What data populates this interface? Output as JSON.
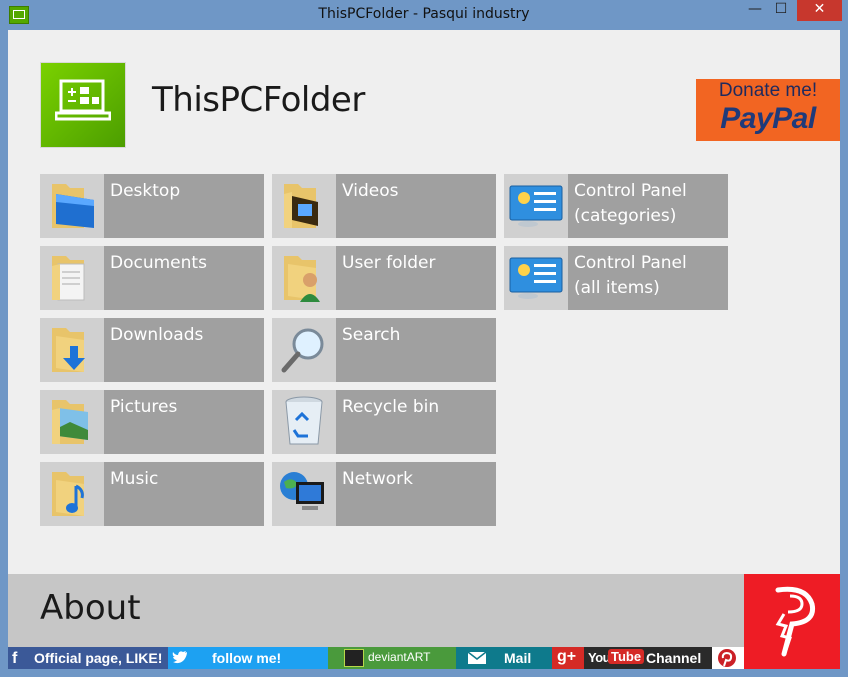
{
  "window": {
    "title": "ThisPCFolder - Pasqui industry",
    "minimize_glyph": "—",
    "maximize_glyph": "☐",
    "close_glyph": "✕"
  },
  "header": {
    "app_name": "ThisPCFolder",
    "donate_line1": "Donate me!",
    "donate_line2": "PayPal"
  },
  "tiles": [
    {
      "label": "Desktop",
      "icon": "desktop-folder-icon"
    },
    {
      "label": "Documents",
      "icon": "documents-folder-icon"
    },
    {
      "label": "Downloads",
      "icon": "downloads-folder-icon"
    },
    {
      "label": "Pictures",
      "icon": "pictures-folder-icon"
    },
    {
      "label": "Music",
      "icon": "music-folder-icon"
    },
    {
      "label": "Videos",
      "icon": "videos-folder-icon"
    },
    {
      "label": "User folder",
      "icon": "user-folder-icon"
    },
    {
      "label": "Search",
      "icon": "search-icon"
    },
    {
      "label": "Recycle bin",
      "icon": "recycle-bin-icon"
    },
    {
      "label": "Network",
      "icon": "network-icon"
    },
    {
      "label": "Control Panel\n(categories)",
      "icon": "control-panel-icon"
    },
    {
      "label": "Control Panel\n(all items)",
      "icon": "control-panel-icon"
    }
  ],
  "footer": {
    "about_label": "About",
    "facebook_label": "Official page, LIKE!",
    "twitter_label": "follow me!",
    "deviantart_label": "deviantART",
    "mail_label": "Mail",
    "youtube_you": "You",
    "youtube_tube": "Tube",
    "channel_label": "Channel",
    "gplus_label": "g+"
  },
  "colors": {
    "tile_bg": "#a0a0a0",
    "tile_icon_bg": "#d0d0d0",
    "paypal_orange": "#f26522",
    "facebook": "#3b5998",
    "twitter": "#1da1f2",
    "deviantart": "#4a9a3c",
    "mail": "#0e7a8c",
    "youtube": "#d52a26"
  }
}
